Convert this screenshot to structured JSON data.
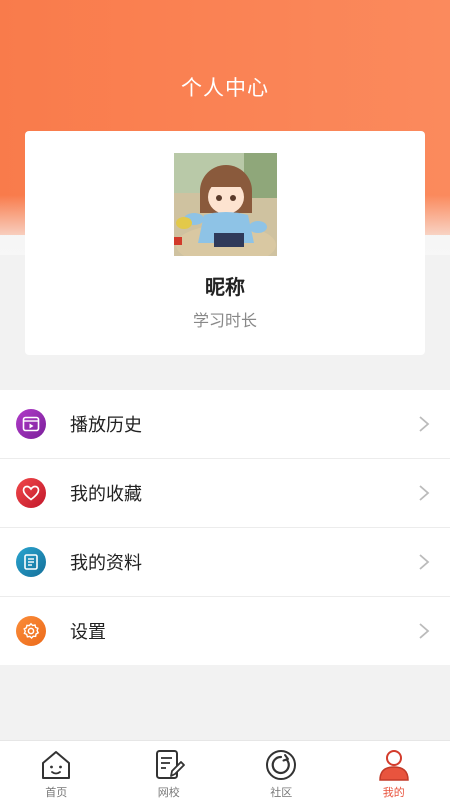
{
  "header": {
    "title": "个人中心"
  },
  "profile": {
    "nickname": "昵称",
    "study_time": "学习时长"
  },
  "menu": {
    "items": [
      {
        "label": "播放历史",
        "icon": "video-icon",
        "color": "#8e24aa"
      },
      {
        "label": "我的收藏",
        "icon": "heart-icon",
        "color": "#e53935"
      },
      {
        "label": "我的资料",
        "icon": "document-icon",
        "color": "#1e88b8"
      },
      {
        "label": "设置",
        "icon": "gear-icon",
        "color": "#f57c2a"
      }
    ]
  },
  "tabbar": {
    "tabs": [
      {
        "label": "首页",
        "icon": "home-icon"
      },
      {
        "label": "网校",
        "icon": "edit-document-icon"
      },
      {
        "label": "社区",
        "icon": "circle-refresh-icon"
      },
      {
        "label": "我的",
        "icon": "person-icon",
        "active": true
      }
    ]
  },
  "colors": {
    "accent": "#f97b4b",
    "active_tab": "#e8543e"
  }
}
